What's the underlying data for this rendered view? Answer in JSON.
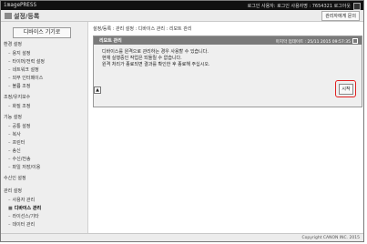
{
  "topbar": {
    "logo": "imagePRESS",
    "userinfo": "로그인 사용자: 로그인 사용자명 : 7654321   로그아웃"
  },
  "header": {
    "title": "설정/등록",
    "manager_link": "관리자에게 문의"
  },
  "sidebar": {
    "home_button": "디바이스 기기로",
    "items": [
      {
        "label": "환경 설정",
        "head": true
      },
      {
        "label": "용지 설정"
      },
      {
        "label": "타이머/전력 설정"
      },
      {
        "label": "네트워크 설정"
      },
      {
        "label": "외부 인터페이스"
      },
      {
        "label": "볼륨 조정"
      },
      {
        "label": "조정/유지보수",
        "head": true
      },
      {
        "label": "화질 조정"
      },
      {
        "label": "기능 설정",
        "head": true
      },
      {
        "label": "공통 설정"
      },
      {
        "label": "복사"
      },
      {
        "label": "프린터"
      },
      {
        "label": "송신"
      },
      {
        "label": "수신/전송"
      },
      {
        "label": "파일 저장/이용"
      },
      {
        "label": "수신인 설정",
        "head": true
      },
      {
        "label": "관리 설정",
        "head": true
      },
      {
        "label": "사용자 관리"
      },
      {
        "label": "디바이스 관리",
        "active": true
      },
      {
        "label": "라이선스/기타"
      },
      {
        "label": "데이터 관리"
      }
    ]
  },
  "main": {
    "breadcrumb": "설정/등록 : 관리 설정 : 디바이스 관리 : 리모트 관리",
    "panel": {
      "title": "리모트 관리",
      "timestamp": "마지막 업데이트 : 25/11 2015 09:57:35",
      "messages": [
        "디바이스를 원격으로 관리하는 경우 사용할 수 있습니다.",
        "현재 실행중인 작업은 되돌릴 수 없습니다.",
        "원격 처리가 종료되면 결과를 확인한 후 종료해 주십시오."
      ],
      "start_button": "시작"
    }
  },
  "footer": {
    "copyright": "Copyright CANON INC. 2015"
  }
}
